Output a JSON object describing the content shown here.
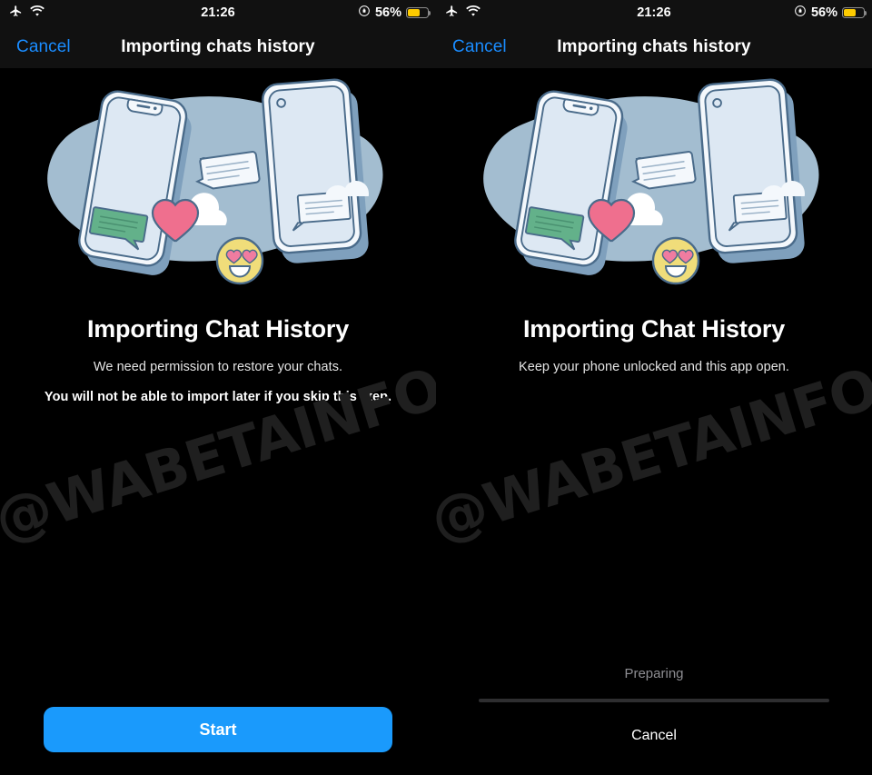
{
  "screens": [
    {
      "id": "permission",
      "status_bar": {
        "airplane_icon": "airplane-mode-icon",
        "wifi_icon": "wifi-icon",
        "time": "21:26",
        "lock_rotation_icon": "rotation-lock-icon",
        "battery_percent": "56%",
        "battery_level": 56
      },
      "nav": {
        "cancel_label": "Cancel",
        "title": "Importing chats history"
      },
      "illustration": "two-phones-chat-transfer-illustration",
      "headline": "Importing Chat History",
      "subline": "We need permission to restore your chats.",
      "warnline": "You will not be able to import later if you skip this step.",
      "primary_button": "Start"
    },
    {
      "id": "progress",
      "status_bar": {
        "airplane_icon": "airplane-mode-icon",
        "wifi_icon": "wifi-icon",
        "time": "21:26",
        "lock_rotation_icon": "rotation-lock-icon",
        "battery_percent": "56%",
        "battery_level": 56
      },
      "nav": {
        "cancel_label": "Cancel",
        "title": "Importing chats history"
      },
      "illustration": "two-phones-chat-transfer-illustration",
      "headline": "Importing Chat History",
      "subline": "Keep your phone unlocked and this app open.",
      "progress_label": "Preparing",
      "progress_percent": 0,
      "cancel_button": "Cancel"
    }
  ],
  "watermark": "@WABETAINFO",
  "colors": {
    "accent_blue": "#1a9afc",
    "link_blue": "#1a8cff",
    "battery_yellow": "#ffcc00",
    "illo_blob": "#a3bdd0",
    "illo_phone_body": "#dde8f3",
    "illo_outline": "#4a6b8a",
    "illo_bubble_green": "#63b18a",
    "illo_heart_pink": "#ef6f8e",
    "illo_emoji_yellow": "#f0dd7a",
    "background": "#000000",
    "bar_background": "#111111"
  }
}
